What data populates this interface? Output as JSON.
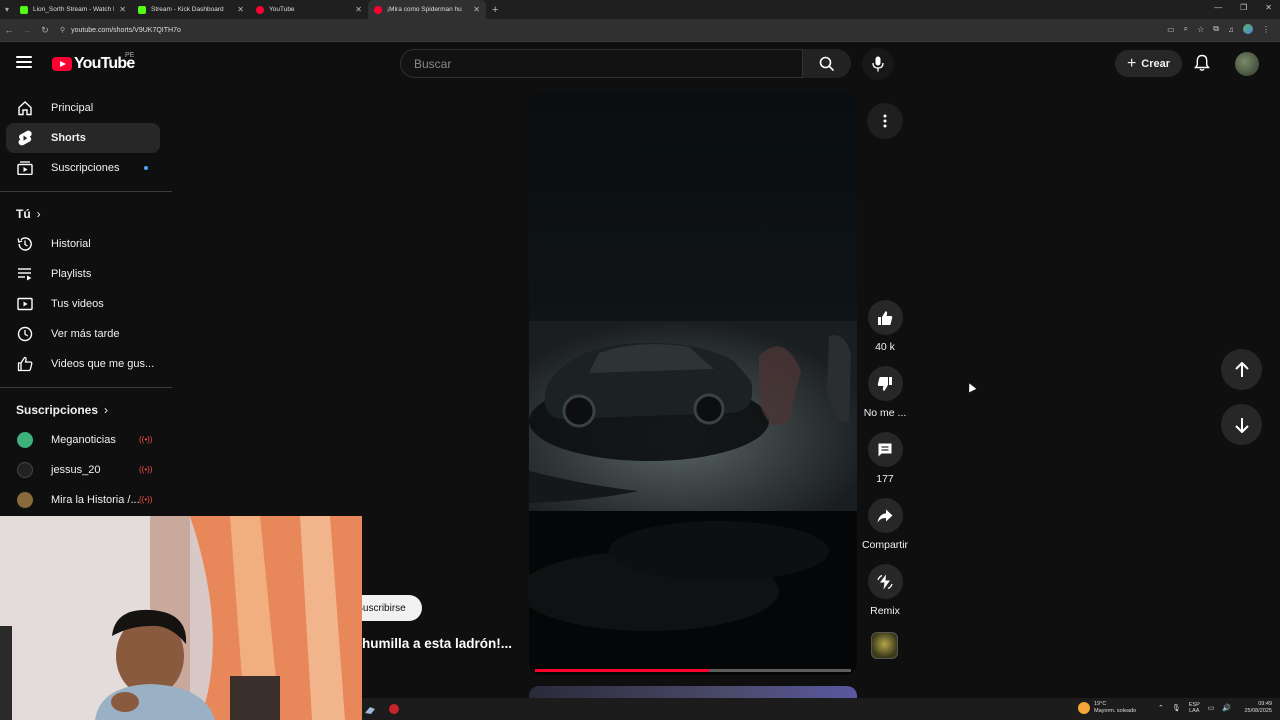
{
  "browser": {
    "tabs": [
      {
        "title": "Lion_Sorth Stream - Watch Live",
        "color": "#53fc18"
      },
      {
        "title": "Stream - Kick Dashboard",
        "color": "#53fc18"
      },
      {
        "title": "YouTube",
        "color": "#ff0033"
      },
      {
        "title": "¡Mira como Spiderman hu",
        "color": "#ff0033"
      }
    ],
    "url": "youtube.com/shorts/V9UK7QITH7o"
  },
  "header": {
    "logo_text": "YouTube",
    "country": "PE",
    "search_placeholder": "Buscar",
    "create_label": "Crear"
  },
  "sidebar": {
    "main": [
      {
        "label": "Principal",
        "icon": "home-icon"
      },
      {
        "label": "Shorts",
        "icon": "shorts-icon"
      },
      {
        "label": "Suscripciones",
        "icon": "subscriptions-icon"
      }
    ],
    "you_label": "Tú",
    "you_items": [
      {
        "label": "Historial",
        "icon": "history-icon"
      },
      {
        "label": "Playlists",
        "icon": "playlists-icon"
      },
      {
        "label": "Tus videos",
        "icon": "your-videos-icon"
      },
      {
        "label": "Ver más tarde",
        "icon": "watch-later-icon"
      },
      {
        "label": "Videos que me gus...",
        "icon": "liked-videos-icon"
      }
    ],
    "subs_label": "Suscripciones",
    "subs": [
      {
        "label": "Meganoticias",
        "color": "#3fb07a"
      },
      {
        "label": "jessus_20",
        "color": "#222222"
      },
      {
        "label": "Mira la Historia /...",
        "color": "#8a6a3a"
      }
    ]
  },
  "short": {
    "title": "humilla a esta ladrón!...",
    "subscribe_label": "Suscribirse",
    "progress": 0.55,
    "actions": {
      "like": "40 k",
      "dislike": "No me ...",
      "comments": "177",
      "share": "Compartir",
      "remix": "Remix"
    }
  },
  "taskbar": {
    "weather_temp": "19°C",
    "weather_desc": "Mayorm. soleado",
    "lang_top": "ESP",
    "lang_bottom": "LAA",
    "time": "09:49",
    "date": "25/08/2025"
  }
}
